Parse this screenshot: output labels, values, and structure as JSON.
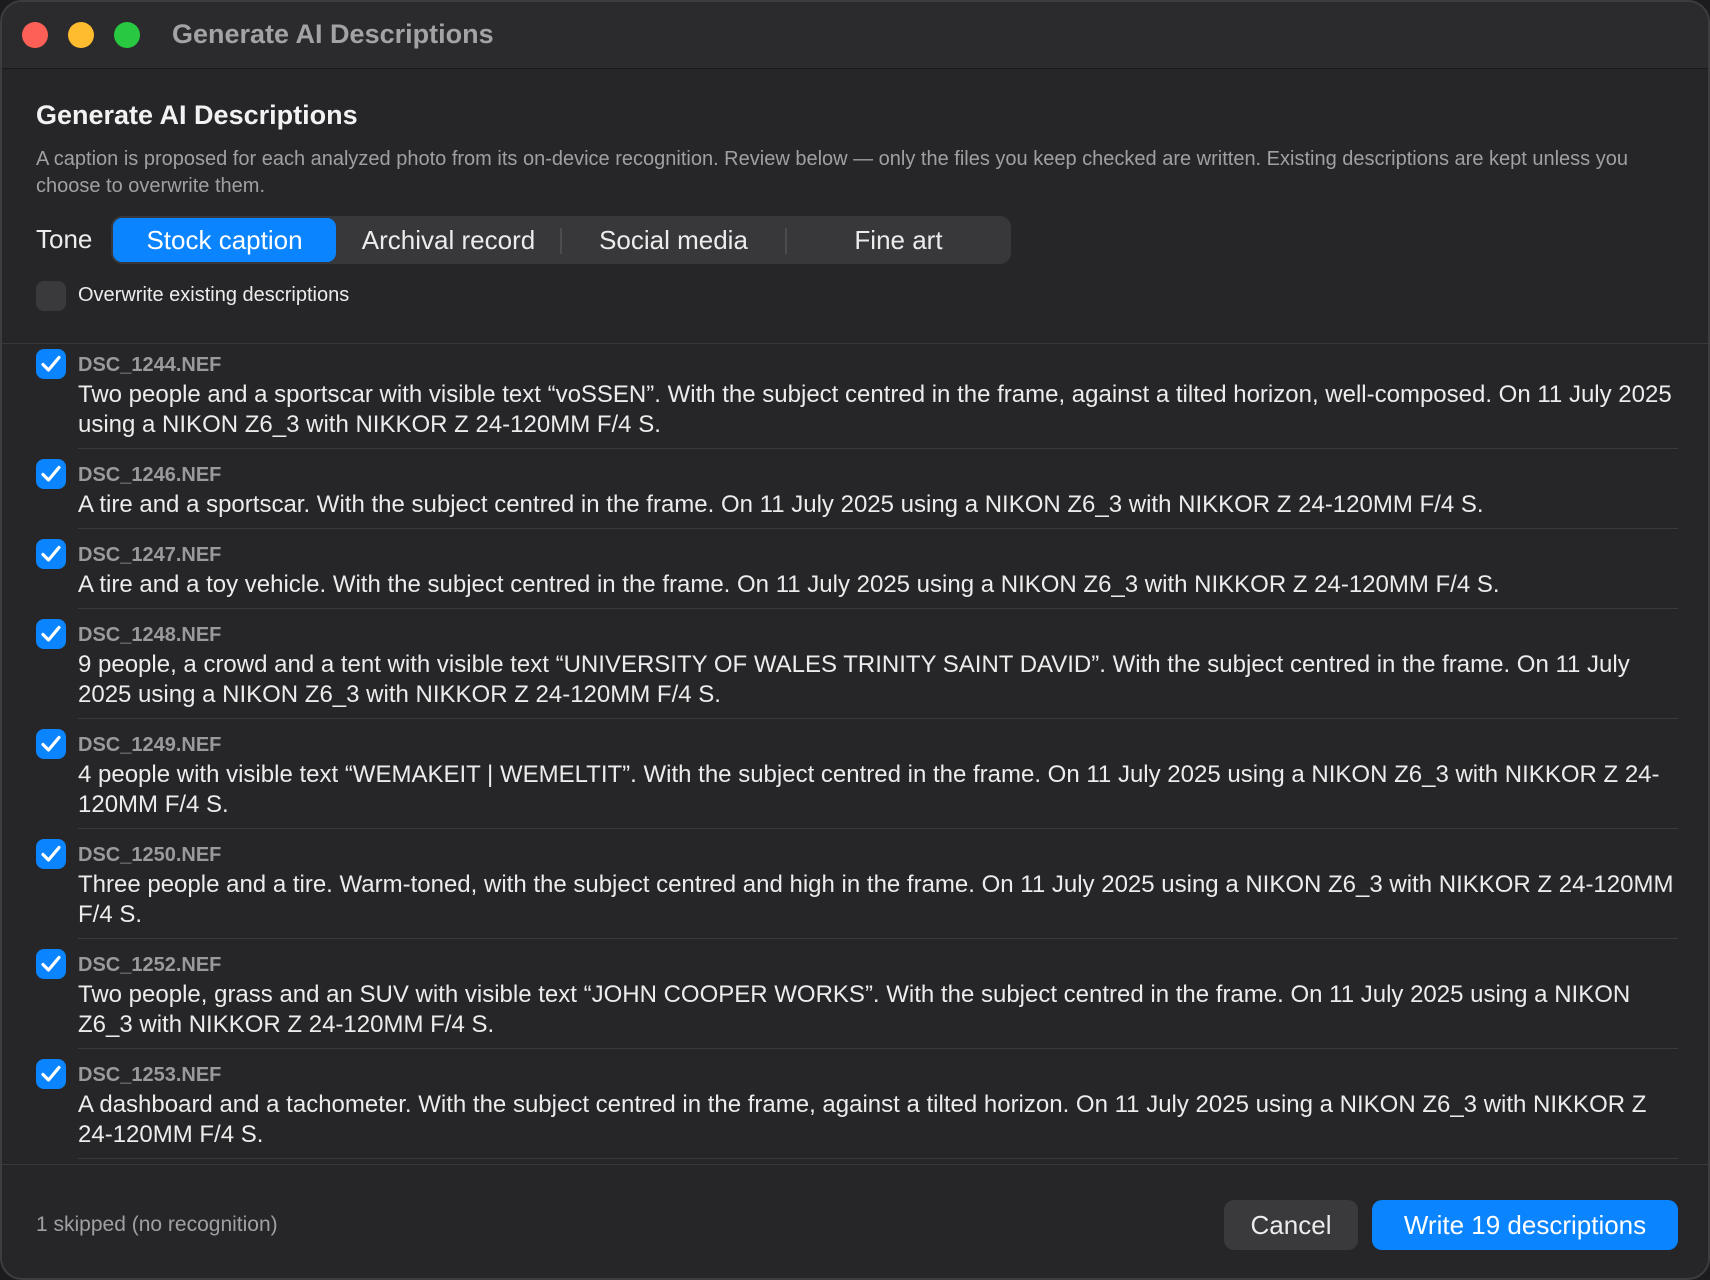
{
  "window": {
    "title": "Generate AI Descriptions"
  },
  "dialog": {
    "heading": "Generate AI Descriptions",
    "description": "A caption is proposed for each analyzed photo from its on-device recognition. Review below — only the files you keep checked are written. Existing descriptions are kept unless you choose to overwrite them."
  },
  "tone": {
    "label": "Tone",
    "options": [
      "Stock caption",
      "Archival record",
      "Social media",
      "Fine art"
    ],
    "selected": "Stock caption"
  },
  "overwrite": {
    "label": "Overwrite existing descriptions",
    "checked": false
  },
  "items": [
    {
      "file": "DSC_1244.NEF",
      "checked": true,
      "caption": "Two people and a sportscar with visible text “voSSEN”. With the subject centred in the frame, against a tilted horizon, well-composed. On 11 July 2025 using a NIKON Z6_3 with NIKKOR Z 24-120MM F/4 S."
    },
    {
      "file": "DSC_1246.NEF",
      "checked": true,
      "caption": "A tire and a sportscar. With the subject centred in the frame. On 11 July 2025 using a NIKON Z6_3 with NIKKOR Z 24-120MM F/4 S."
    },
    {
      "file": "DSC_1247.NEF",
      "checked": true,
      "caption": "A tire and a toy vehicle. With the subject centred in the frame. On 11 July 2025 using a NIKON Z6_3 with NIKKOR Z 24-120MM F/4 S."
    },
    {
      "file": "DSC_1248.NEF",
      "checked": true,
      "caption": "9 people, a crowd and a tent with visible text “UNIVERSITY OF WALES TRINITY SAINT DAVID”. With the subject centred in the frame. On 11 July 2025 using a NIKON Z6_3 with NIKKOR Z 24-120MM F/4 S."
    },
    {
      "file": "DSC_1249.NEF",
      "checked": true,
      "caption": "4 people with visible text “WEMAKEIT | WEMELTIT”. With the subject centred in the frame. On 11 July 2025 using a NIKON Z6_3 with NIKKOR Z 24-120MM F/4 S."
    },
    {
      "file": "DSC_1250.NEF",
      "checked": true,
      "caption": "Three people and a tire. Warm-toned, with the subject centred and high in the frame. On 11 July 2025 using a NIKON Z6_3 with NIKKOR Z 24-120MM F/4 S."
    },
    {
      "file": "DSC_1252.NEF",
      "checked": true,
      "caption": "Two people, grass and an SUV with visible text “JOHN COOPER WORKS”. With the subject centred in the frame. On 11 July 2025 using a NIKON Z6_3 with NIKKOR Z 24-120MM F/4 S."
    },
    {
      "file": "DSC_1253.NEF",
      "checked": true,
      "caption": "A dashboard and a tachometer. With the subject centred in the frame, against a tilted horizon. On 11 July 2025 using a NIKON Z6_3 with NIKKOR Z 24-120MM F/4 S."
    }
  ],
  "footer": {
    "status": "1 skipped (no recognition)",
    "cancel_label": "Cancel",
    "primary_label": "Write 19 descriptions"
  },
  "colors": {
    "accent": "#0a84ff",
    "background": "#262628",
    "close": "#fe5f57",
    "minimize": "#febc2e",
    "zoom": "#28c840"
  },
  "icons": {
    "checkbox": "checkmark-icon"
  }
}
